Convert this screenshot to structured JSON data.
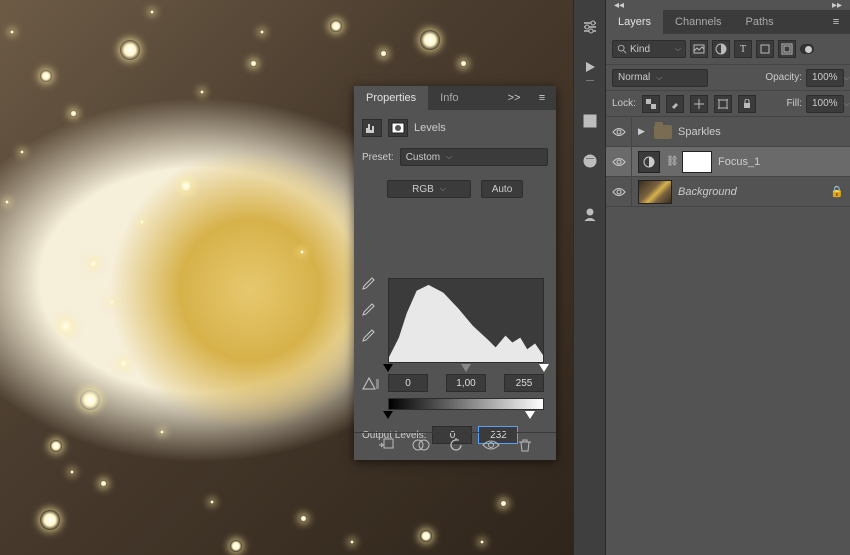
{
  "panels": {
    "properties": {
      "tabs": [
        "Properties",
        "Info"
      ],
      "active_tab": 0,
      "title": "Levels",
      "preset_label": "Preset:",
      "preset_value": "Custom",
      "channel_value": "RGB",
      "auto_label": "Auto",
      "input_levels": {
        "black": "0",
        "mid": "1,00",
        "white": "255"
      },
      "output_label": "Output Levels:",
      "output_levels": {
        "black": "0",
        "white": "232"
      }
    },
    "layers": {
      "tabs": [
        "Layers",
        "Channels",
        "Paths"
      ],
      "active_tab": 0,
      "filter": {
        "kind_label": "Kind"
      },
      "blend_mode": "Normal",
      "opacity_label": "Opacity:",
      "opacity_value": "100%",
      "lock_label": "Lock:",
      "fill_label": "Fill:",
      "fill_value": "100%",
      "items": [
        {
          "type": "group",
          "name": "Sparkles",
          "visible": true,
          "collapsed": true
        },
        {
          "type": "adjustment",
          "name": "Focus_1",
          "visible": true,
          "selected": true,
          "has_mask": true
        },
        {
          "type": "pixel",
          "name": "Background",
          "visible": true,
          "locked": true,
          "italic": true
        }
      ]
    }
  },
  "collapse_glyph_left": "◂◂",
  "collapse_glyph_right": "▸▸"
}
